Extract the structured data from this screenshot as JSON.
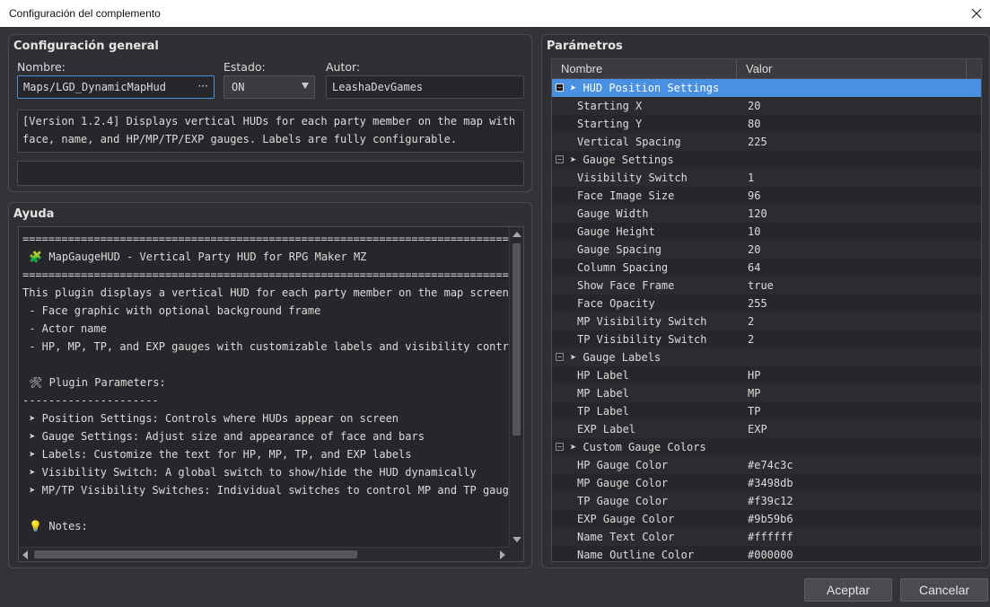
{
  "window": {
    "title": "Configuración del complemento"
  },
  "general": {
    "title": "Configuración general",
    "name_label": "Nombre:",
    "name_value": "Maps/LGD_DynamicMapHud",
    "name_browse": "···",
    "status_label": "Estado:",
    "status_value": "ON",
    "author_label": "Autor:",
    "author_value": "LeashaDevGames",
    "description_lines": [
      "[Version 1.2.4] Displays vertical HUDs for each party member on the map with",
      "face, name, and HP/MP/TP/EXP gauges. Labels are fully configurable."
    ],
    "extra_value": ""
  },
  "help": {
    "title": "Ayuda",
    "lines": [
      "============================================================================",
      " 🧩 MapGaugeHUD - Vertical Party HUD for RPG Maker MZ",
      "============================================================================",
      "This plugin displays a vertical HUD for each party member on the map screen,",
      " - Face graphic with optional background frame",
      " - Actor name",
      " - HP, MP, TP, and EXP gauges with customizable labels and visibility controls",
      "",
      " 🛠 Plugin Parameters:",
      "---------------------",
      " ➤ Position Settings: Controls where HUDs appear on screen",
      " ➤ Gauge Settings: Adjust size and appearance of face and bars",
      " ➤ Labels: Customize the text for HP, MP, TP, and EXP labels",
      " ➤ Visibility Switch: A global switch to show/hide the HUD dynamically",
      " ➤ MP/TP Visibility Switches: Individual switches to control MP and TP gauges",
      "",
      " 💡 Notes:"
    ]
  },
  "params": {
    "title": "Parámetros",
    "col_name": "Nombre",
    "col_value": "Valor",
    "rows": [
      {
        "name": "➤ HUD Position Settings",
        "value": "",
        "group": true,
        "selected": true
      },
      {
        "name": "Starting X",
        "value": "20"
      },
      {
        "name": "Starting Y",
        "value": "80"
      },
      {
        "name": "Vertical Spacing",
        "value": "225"
      },
      {
        "name": "➤ Gauge Settings",
        "value": "",
        "group": true
      },
      {
        "name": "Visibility Switch",
        "value": "1"
      },
      {
        "name": "Face Image Size",
        "value": "96"
      },
      {
        "name": "Gauge Width",
        "value": "120"
      },
      {
        "name": "Gauge Height",
        "value": "10"
      },
      {
        "name": "Gauge Spacing",
        "value": "20"
      },
      {
        "name": "Column Spacing",
        "value": "64"
      },
      {
        "name": "Show Face Frame",
        "value": "true"
      },
      {
        "name": "Face Opacity",
        "value": "255"
      },
      {
        "name": "MP Visibility Switch",
        "value": "2"
      },
      {
        "name": "TP Visibility Switch",
        "value": "2"
      },
      {
        "name": "➤ Gauge Labels",
        "value": "",
        "group": true
      },
      {
        "name": "HP Label",
        "value": "HP"
      },
      {
        "name": "MP Label",
        "value": "MP"
      },
      {
        "name": "TP Label",
        "value": "TP"
      },
      {
        "name": "EXP Label",
        "value": "EXP"
      },
      {
        "name": "➤ Custom Gauge Colors",
        "value": "",
        "group": true
      },
      {
        "name": "HP Gauge Color",
        "value": "#e74c3c"
      },
      {
        "name": "MP Gauge Color",
        "value": "#3498db"
      },
      {
        "name": "TP Gauge Color",
        "value": "#f39c12"
      },
      {
        "name": "EXP Gauge Color",
        "value": "#9b59b6"
      },
      {
        "name": "Name Text Color",
        "value": "#ffffff"
      },
      {
        "name": "Name Outline Color",
        "value": "#000000"
      }
    ]
  },
  "buttons": {
    "accept": "Aceptar",
    "cancel": "Cancelar"
  },
  "colors": {
    "accent": "#4a90e2",
    "background": "#333438"
  }
}
